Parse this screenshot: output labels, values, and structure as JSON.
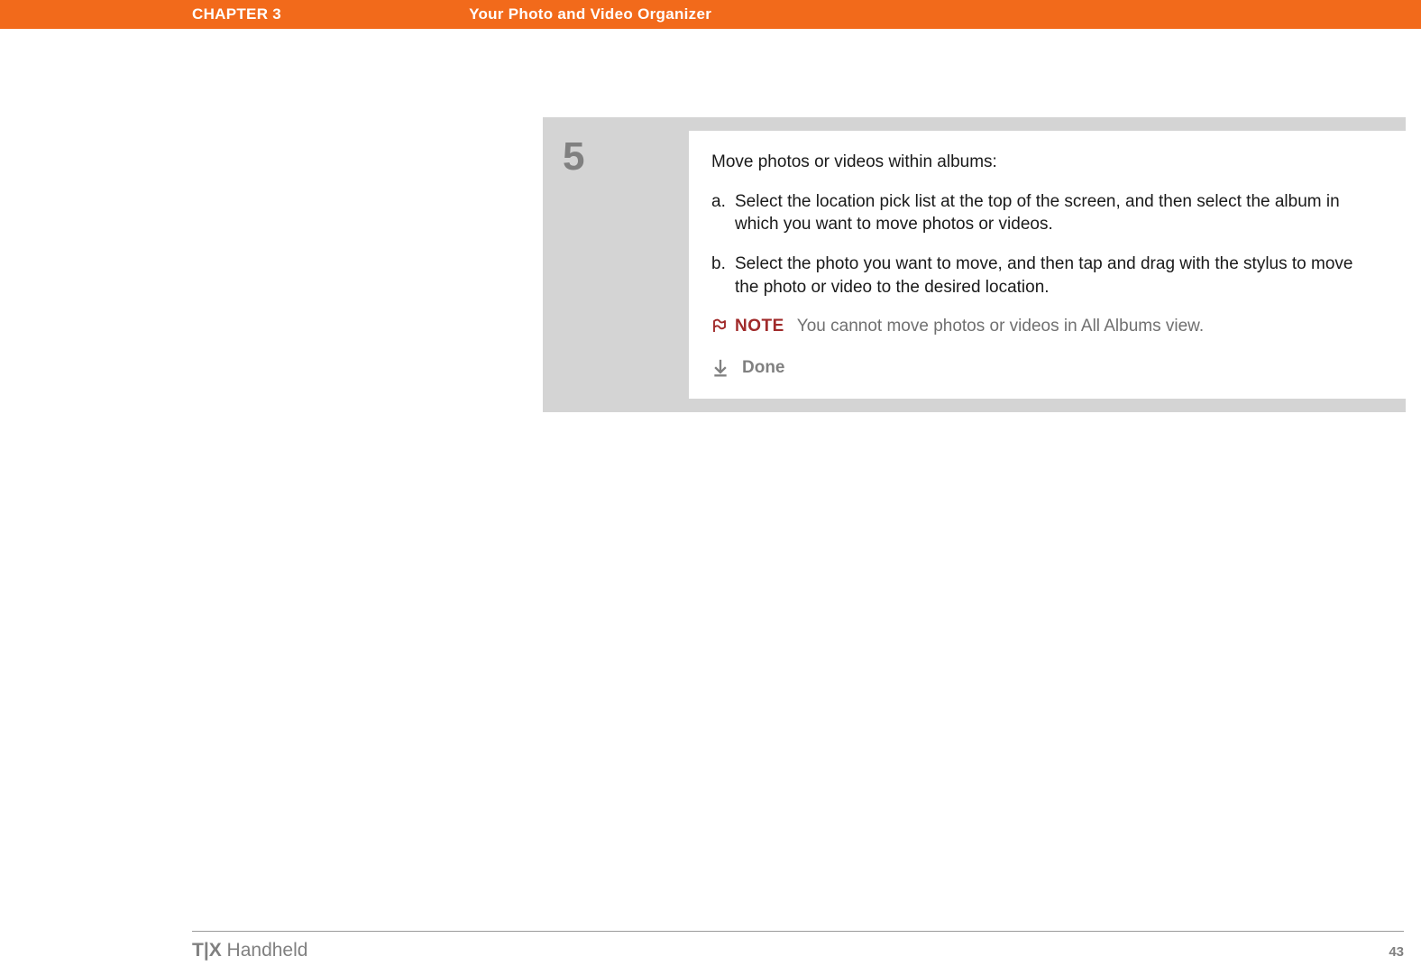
{
  "header": {
    "chapter": "CHAPTER 3",
    "title": "Your Photo and Video Organizer"
  },
  "step": {
    "number": "5",
    "intro": "Move photos or videos within albums:",
    "substeps": {
      "a": {
        "letter": "a.",
        "text": "Select the location pick list at the top of the screen, and then select the album in which you want to move photos or videos."
      },
      "b": {
        "letter": "b.",
        "text": "Select the photo you want to move, and then tap and drag with the stylus to move the photo or video to the desired location."
      }
    },
    "note": {
      "label": "NOTE",
      "text": "You cannot move photos or videos in All Albums view."
    },
    "done": "Done"
  },
  "footer": {
    "device_bold": "T|X",
    "device_rest": " Handheld",
    "page": "43"
  }
}
